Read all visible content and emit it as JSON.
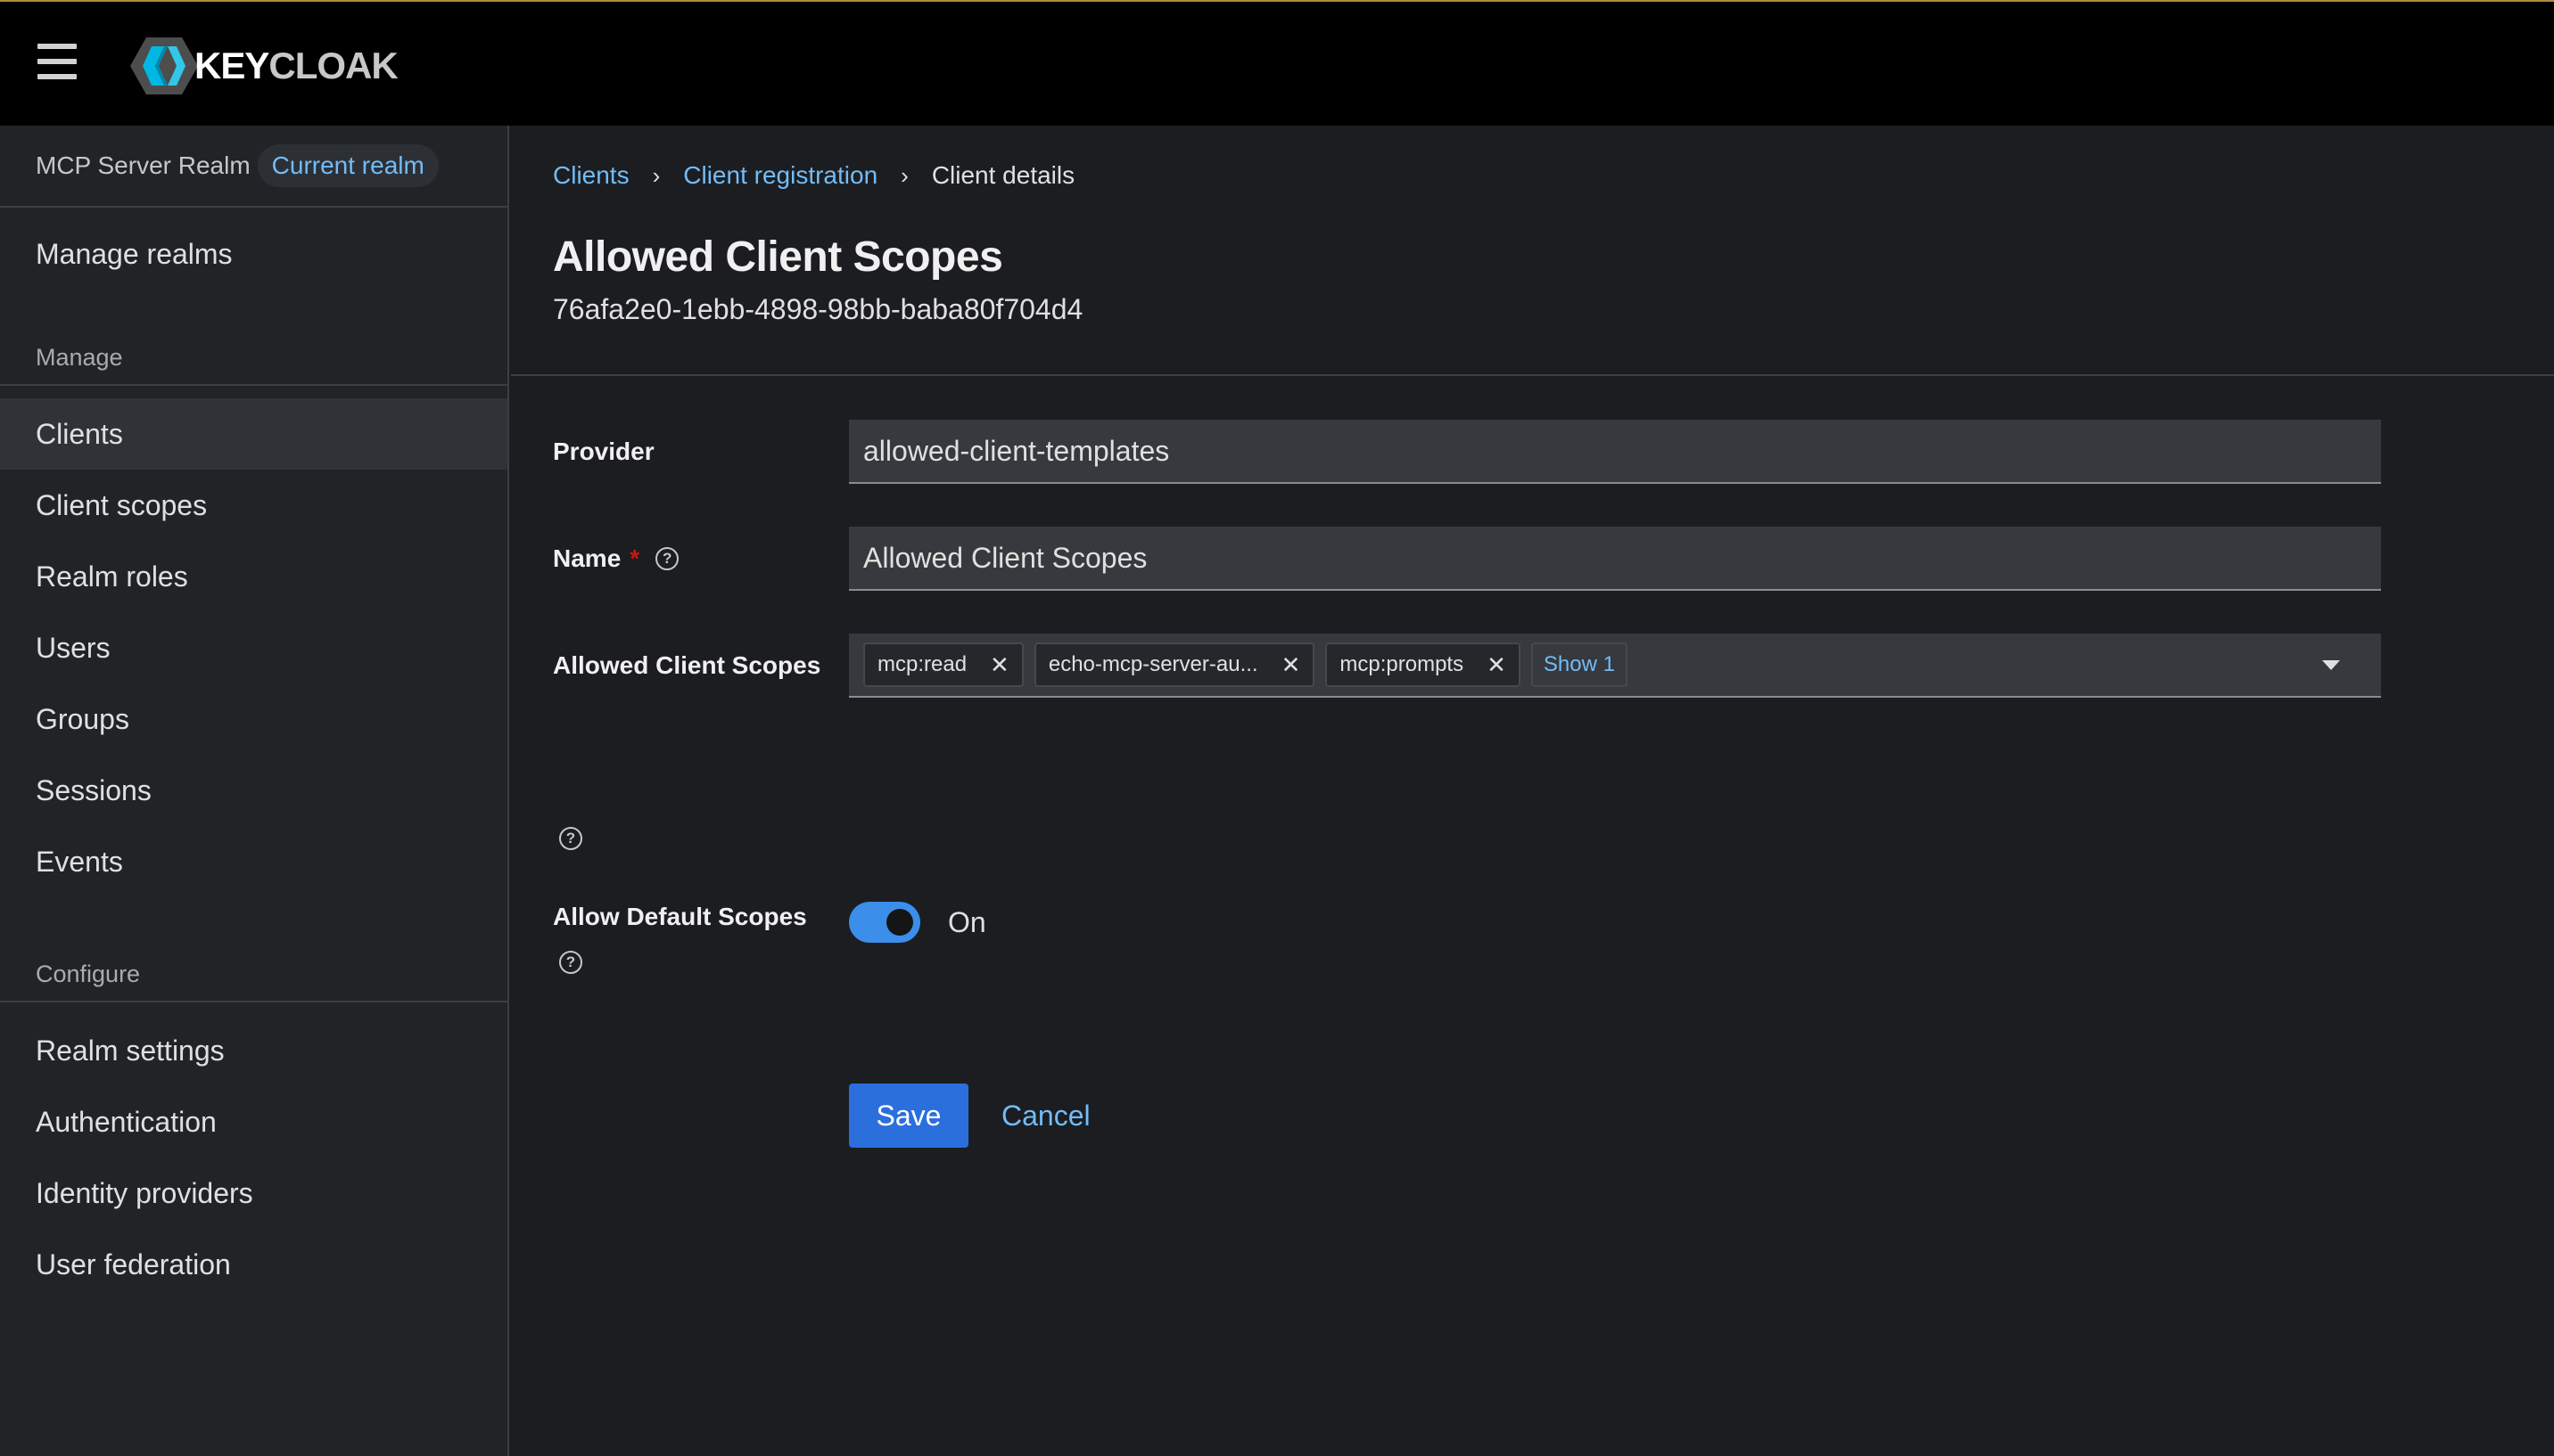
{
  "header": {
    "brand_key": "KEY",
    "brand_cloak": "CLOAK",
    "icons": [
      "hamburger-menu-icon",
      "keycloak-logo-icon"
    ]
  },
  "sidebar": {
    "realm_name": "MCP Server Realm",
    "realm_badge": "Current realm",
    "manage_realms": "Manage realms",
    "manage_title": "Manage",
    "manage_items": [
      "Clients",
      "Client scopes",
      "Realm roles",
      "Users",
      "Groups",
      "Sessions",
      "Events"
    ],
    "active_item": "Clients",
    "configure_title": "Configure",
    "configure_items": [
      "Realm settings",
      "Authentication",
      "Identity providers",
      "User federation"
    ]
  },
  "breadcrumb": {
    "items": [
      "Clients",
      "Client registration",
      "Client details"
    ]
  },
  "page": {
    "title": "Allowed Client Scopes",
    "subtitle": "76afa2e0-1ebb-4898-98bb-baba80f704d4"
  },
  "form": {
    "provider_label": "Provider",
    "provider_value": "allowed-client-templates",
    "name_label": "Name",
    "name_required_mark": "*",
    "name_value": "Allowed Client Scopes",
    "scopes_label": "Allowed Client Scopes",
    "scopes_chips": [
      "mcp:read",
      "echo-mcp-server-au...",
      "mcp:prompts"
    ],
    "scopes_more": "Show 1",
    "default_scopes_label": "Allow Default Scopes",
    "default_scopes_state": "On",
    "help_glyph": "?",
    "chip_close_glyph": "✕",
    "breadcrumb_separator_glyph": "›"
  },
  "actions": {
    "save_label": "Save",
    "cancel_label": "Cancel"
  },
  "colors": {
    "accent": "#73bcf7",
    "primary_button": "#2b6fdc",
    "toggle_on": "#3b8eea",
    "required": "#c9190b"
  }
}
